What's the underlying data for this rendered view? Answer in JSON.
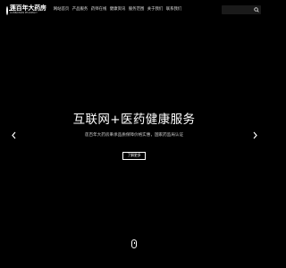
{
  "header": {
    "logo": {
      "name_cn": "莲百年大药房",
      "name_en": "LIANBAINIAN PHARMACY"
    },
    "nav": [
      {
        "label": "网站首页"
      },
      {
        "label": "产品服务"
      },
      {
        "label": "药师在线"
      },
      {
        "label": "健康资讯"
      },
      {
        "label": "服务范围"
      },
      {
        "label": "关于我们"
      },
      {
        "label": "联系我们"
      }
    ],
    "search": {
      "placeholder": ""
    }
  },
  "hero": {
    "title": "互联网+医药健康服务",
    "subtitle": "莲百年大药房秉承品质保障价格实惠，国家药监局认证",
    "cta_label": "了解更多"
  },
  "colors": {
    "background": "#000000",
    "text": "#ffffff"
  }
}
